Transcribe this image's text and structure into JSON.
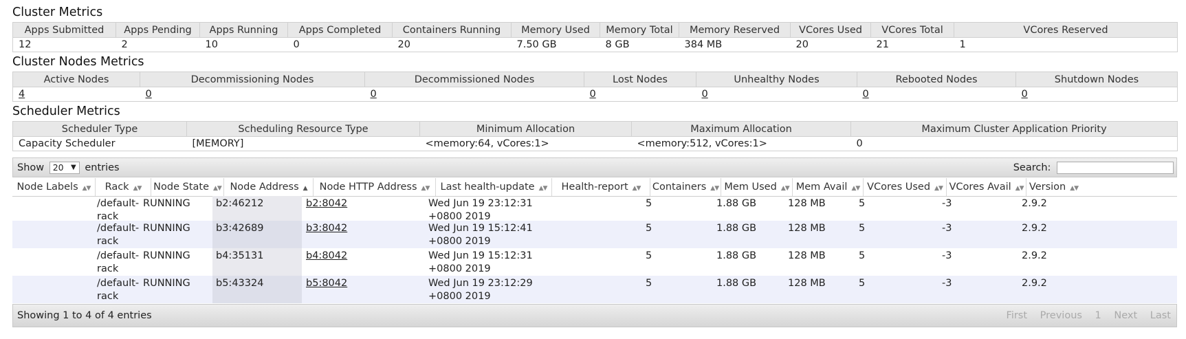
{
  "cluster_metrics": {
    "title": "Cluster Metrics",
    "headers": [
      "Apps Submitted",
      "Apps Pending",
      "Apps Running",
      "Apps Completed",
      "Containers Running",
      "Memory Used",
      "Memory Total",
      "Memory Reserved",
      "VCores Used",
      "VCores Total",
      "VCores Reserved"
    ],
    "values": [
      "12",
      "2",
      "10",
      "0",
      "20",
      "7.50 GB",
      "8 GB",
      "384 MB",
      "20",
      "21",
      "1"
    ]
  },
  "cluster_nodes_metrics": {
    "title": "Cluster Nodes Metrics",
    "headers": [
      "Active Nodes",
      "Decommissioning Nodes",
      "Decommissioned Nodes",
      "Lost Nodes",
      "Unhealthy Nodes",
      "Rebooted Nodes",
      "Shutdown Nodes"
    ],
    "values": [
      "4",
      "0",
      "0",
      "0",
      "0",
      "0",
      "0"
    ]
  },
  "scheduler_metrics": {
    "title": "Scheduler Metrics",
    "headers": [
      "Scheduler Type",
      "Scheduling Resource Type",
      "Minimum Allocation",
      "Maximum Allocation",
      "Maximum Cluster Application Priority"
    ],
    "values": [
      "Capacity Scheduler",
      "[MEMORY]",
      "<memory:64, vCores:1>",
      "<memory:512, vCores:1>",
      "0"
    ]
  },
  "table_controls": {
    "show_label": "Show",
    "page_length": "20",
    "entries_label": "entries",
    "search_label": "Search:",
    "search_value": ""
  },
  "nodes_table": {
    "columns": [
      "Node Labels",
      "Rack",
      "Node State",
      "Node Address",
      "Node HTTP Address",
      "Last health-update",
      "Health-report",
      "Containers",
      "Mem Used",
      "Mem Avail",
      "VCores Used",
      "VCores Avail",
      "Version"
    ],
    "rows": [
      {
        "labels": "",
        "rack1": "/default-",
        "rack2": "rack",
        "state": "RUNNING",
        "address": "b2:46212",
        "http": "b2:8042",
        "health1": "Wed Jun 19 23:12:31",
        "health2": "+0800 2019",
        "report": "",
        "containers": "5",
        "mem_used": "1.88 GB",
        "mem_avail": "128 MB",
        "vcores_used": "5",
        "vcores_avail": "-3",
        "version": "2.9.2"
      },
      {
        "labels": "",
        "rack1": "/default-",
        "rack2": "rack",
        "state": "RUNNING",
        "address": "b3:42689",
        "http": "b3:8042",
        "health1": "Wed Jun 19 15:12:41",
        "health2": "+0800 2019",
        "report": "",
        "containers": "5",
        "mem_used": "1.88 GB",
        "mem_avail": "128 MB",
        "vcores_used": "5",
        "vcores_avail": "-3",
        "version": "2.9.2"
      },
      {
        "labels": "",
        "rack1": "/default-",
        "rack2": "rack",
        "state": "RUNNING",
        "address": "b4:35131",
        "http": "b4:8042",
        "health1": "Wed Jun 19 15:12:31",
        "health2": "+0800 2019",
        "report": "",
        "containers": "5",
        "mem_used": "1.88 GB",
        "mem_avail": "128 MB",
        "vcores_used": "5",
        "vcores_avail": "-3",
        "version": "2.9.2"
      },
      {
        "labels": "",
        "rack1": "/default-",
        "rack2": "rack",
        "state": "RUNNING",
        "address": "b5:43324",
        "http": "b5:8042",
        "health1": "Wed Jun 19 23:12:29",
        "health2": "+0800 2019",
        "report": "",
        "containers": "5",
        "mem_used": "1.88 GB",
        "mem_avail": "128 MB",
        "vcores_used": "5",
        "vcores_avail": "-3",
        "version": "2.9.2"
      }
    ]
  },
  "footer": {
    "info": "Showing 1 to 4 of 4 entries",
    "first": "First",
    "previous": "Previous",
    "page": "1",
    "next": "Next",
    "last": "Last"
  }
}
